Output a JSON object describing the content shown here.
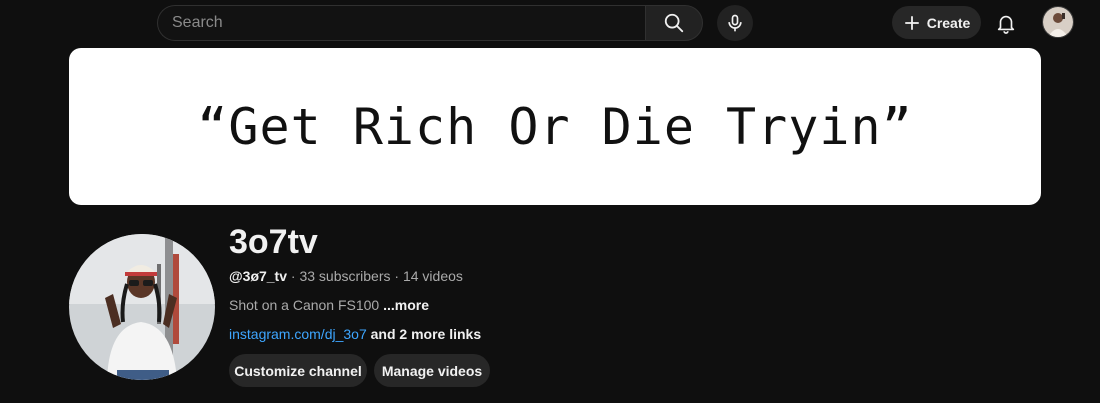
{
  "header": {
    "search": {
      "placeholder": "Search",
      "value": ""
    },
    "search_icon": "search-icon",
    "mic_icon": "microphone-icon",
    "create_label": "Create",
    "bell_icon": "bell-icon"
  },
  "banner": {
    "text": "“Get Rich Or Die Tryin”"
  },
  "channel": {
    "name": "3o7tv",
    "handle": "@3ø7_tv",
    "separator1": " · ",
    "subscribers": "33 subscribers",
    "separator2": " · ",
    "videos": "14 videos",
    "description": "Shot on a Canon FS100",
    "more_label": " ...more",
    "link_url": "instagram.com/dj_3o7",
    "link_more": " and 2 more links"
  },
  "actions": {
    "customize_label": "Customize channel",
    "manage_label": "Manage videos"
  },
  "colors": {
    "background": "#0f0f0f",
    "text": "#f1f1f1",
    "muted": "#aaaaaa",
    "link": "#3ea6ff",
    "pill": "#272727"
  }
}
